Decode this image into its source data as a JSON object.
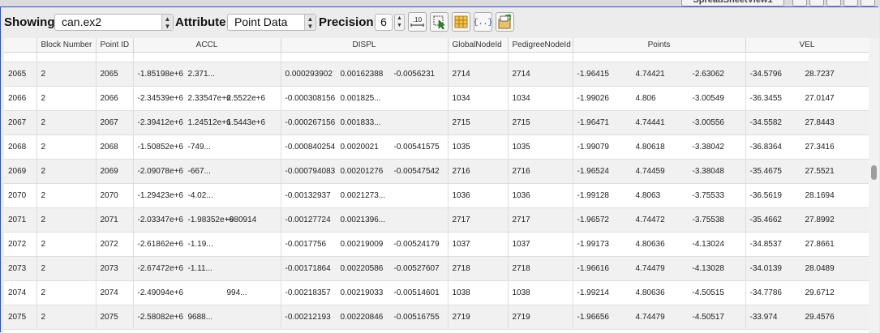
{
  "window": {
    "title_fragment": "SpreadSheetView1"
  },
  "toolbar": {
    "showing_label": "Showing",
    "showing_value": "can.ex2",
    "attribute_label": "Attribute:",
    "attribute_value": "Point Data",
    "precision_label": "Precision:",
    "precision_value": "6",
    "fixed_notation_icon_text": ".10",
    "tools": [
      "fixed-representation-icon",
      "show-only-selected-icon",
      "toggle-columns-icon",
      "toggle-cell-connectivity-icon",
      "export-spreadsheet-icon"
    ]
  },
  "table": {
    "columns": [
      "",
      "Block Number",
      "Point ID",
      "ACCL",
      "DISPL",
      "GlobalNodeId",
      "PedigreeNodeId",
      "Points",
      "VEL"
    ],
    "rows": [
      [
        "2065",
        "2",
        "2065",
        [
          "-1.85198e+6",
          "2.371..."
        ],
        [
          "0.000293902",
          "0.00162388",
          "-0.0056231"
        ],
        "2714",
        "2714",
        [
          "-1.96415",
          "4.74421",
          "-2.63062"
        ],
        [
          "-34.5796",
          "28.7237"
        ]
      ],
      [
        "2066",
        "2",
        "2066",
        [
          "-2.34539e+6",
          "2.33547e+6",
          "2.5522e+6"
        ],
        [
          "-0.000308156",
          "0.001825...",
          ""
        ],
        "1034",
        "1034",
        [
          "-1.99026",
          "4.806",
          "-3.00549"
        ],
        [
          "-36.3455",
          "27.0147"
        ]
      ],
      [
        "2067",
        "2",
        "2067",
        [
          "-2.39412e+6",
          "1.24512e+6",
          "1.5443e+6"
        ],
        [
          "-0.000267156",
          "0.001833...",
          ""
        ],
        "2715",
        "2715",
        [
          "-1.96471",
          "4.74441",
          "-3.00556"
        ],
        [
          "-34.5582",
          "27.8443"
        ]
      ],
      [
        "2068",
        "2",
        "2068",
        [
          "-1.50852e+6",
          "-749...",
          ""
        ],
        [
          "-0.000840254",
          "0.0020021",
          "-0.00541575"
        ],
        "1035",
        "1035",
        [
          "-1.99079",
          "4.80618",
          "-3.38042"
        ],
        [
          "-36.8364",
          "27.3416"
        ]
      ],
      [
        "2069",
        "2",
        "2069",
        [
          "-2.09078e+6",
          "-667...",
          ""
        ],
        [
          "-0.000794083",
          "0.00201276",
          "-0.00547542"
        ],
        "2716",
        "2716",
        [
          "-1.96524",
          "4.74459",
          "-3.38048"
        ],
        [
          "-35.4675",
          "27.5521"
        ]
      ],
      [
        "2070",
        "2",
        "2070",
        [
          "-1.29423e+6",
          "-4.02...",
          ""
        ],
        [
          "-0.00132937",
          "0.0021273...",
          ""
        ],
        "1036",
        "1036",
        [
          "-1.99128",
          "4.8063",
          "-3.75533"
        ],
        [
          "-36.5619",
          "28.1694"
        ]
      ],
      [
        "2071",
        "2",
        "2071",
        [
          "-2.03347e+6",
          "-1.98352e+6",
          "-980914"
        ],
        [
          "-0.00127724",
          "0.0021396...",
          ""
        ],
        "2717",
        "2717",
        [
          "-1.96572",
          "4.74472",
          "-3.75538"
        ],
        [
          "-35.4662",
          "27.8992"
        ]
      ],
      [
        "2072",
        "2",
        "2072",
        [
          "-2.61862e+6",
          "-1.19...",
          ""
        ],
        [
          "-0.0017756",
          "0.00219009",
          "-0.00524179"
        ],
        "1037",
        "1037",
        [
          "-1.99173",
          "4.80636",
          "-4.13024"
        ],
        [
          "-34.8537",
          "27.8661"
        ]
      ],
      [
        "2073",
        "2",
        "2073",
        [
          "-2.67472e+6",
          "-1.11...",
          ""
        ],
        [
          "-0.00171864",
          "0.00220586",
          "-0.00527607"
        ],
        "2718",
        "2718",
        [
          "-1.96616",
          "4.74479",
          "-4.13028"
        ],
        [
          "-34.0139",
          "28.0489"
        ]
      ],
      [
        "2074",
        "2",
        "2074",
        [
          "-2.49094e+6",
          "",
          "994..."
        ],
        [
          "-0.00218357",
          "0.00219033",
          "-0.00514601"
        ],
        "1038",
        "1038",
        [
          "-1.99214",
          "4.80636",
          "-4.50515"
        ],
        [
          "-34.7786",
          "29.6712"
        ]
      ],
      [
        "2075",
        "2",
        "2075",
        [
          "-2.58082e+6",
          "9688...",
          ""
        ],
        [
          "-0.00212193",
          "0.00220846",
          "-0.00516755"
        ],
        "2719",
        "2719",
        [
          "-1.96656",
          "4.74479",
          "-4.50517"
        ],
        [
          "-33.974",
          "29.4576"
        ]
      ]
    ]
  }
}
